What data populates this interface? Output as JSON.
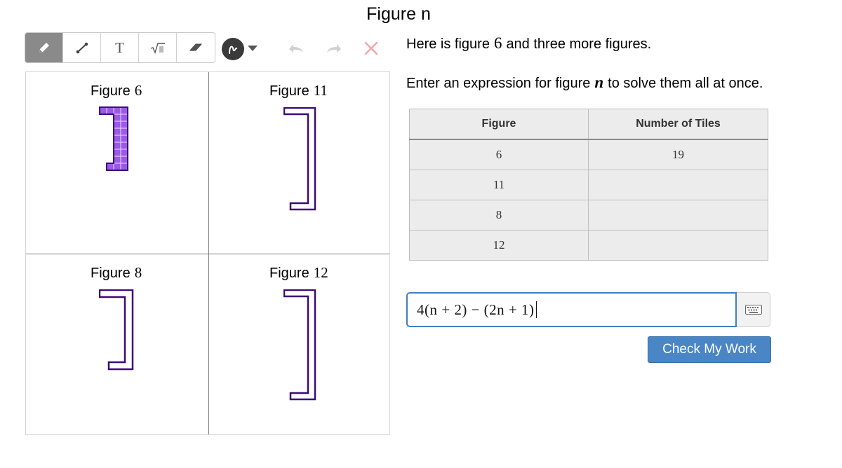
{
  "title": "Figure n",
  "toolbar": {
    "tools": [
      {
        "name": "pencil-icon"
      },
      {
        "name": "line-icon"
      },
      {
        "name": "text-tool",
        "label": "T"
      },
      {
        "name": "math-icon"
      },
      {
        "name": "eraser-icon"
      }
    ],
    "active_tool": "pencil",
    "color_button": "pen-color-icon",
    "undo": "undo-icon",
    "redo": "redo-icon",
    "clear": "close-icon"
  },
  "figures": [
    {
      "label": "Figure",
      "number": "6"
    },
    {
      "label": "Figure",
      "number": "11"
    },
    {
      "label": "Figure",
      "number": "8"
    },
    {
      "label": "Figure",
      "number": "12"
    }
  ],
  "prompt": {
    "line1_before": "Here is figure",
    "line1_value": "6",
    "line1_after": "and three more figures.",
    "line2_before": "Enter an expression for figure",
    "line2_var": "n",
    "line2_after": "to solve them all at once."
  },
  "table": {
    "headers": [
      "Figure",
      "Number of Tiles"
    ],
    "rows": [
      [
        "6",
        "19"
      ],
      [
        "11",
        ""
      ],
      [
        "8",
        ""
      ],
      [
        "12",
        ""
      ]
    ]
  },
  "expression": "4(n + 2) − (2n + 1)",
  "check_button": "Check My Work",
  "colors": {
    "accent": "#4a86c5",
    "figure_outline": "#3b0a7a",
    "tile_fill": "#9b59e8"
  }
}
